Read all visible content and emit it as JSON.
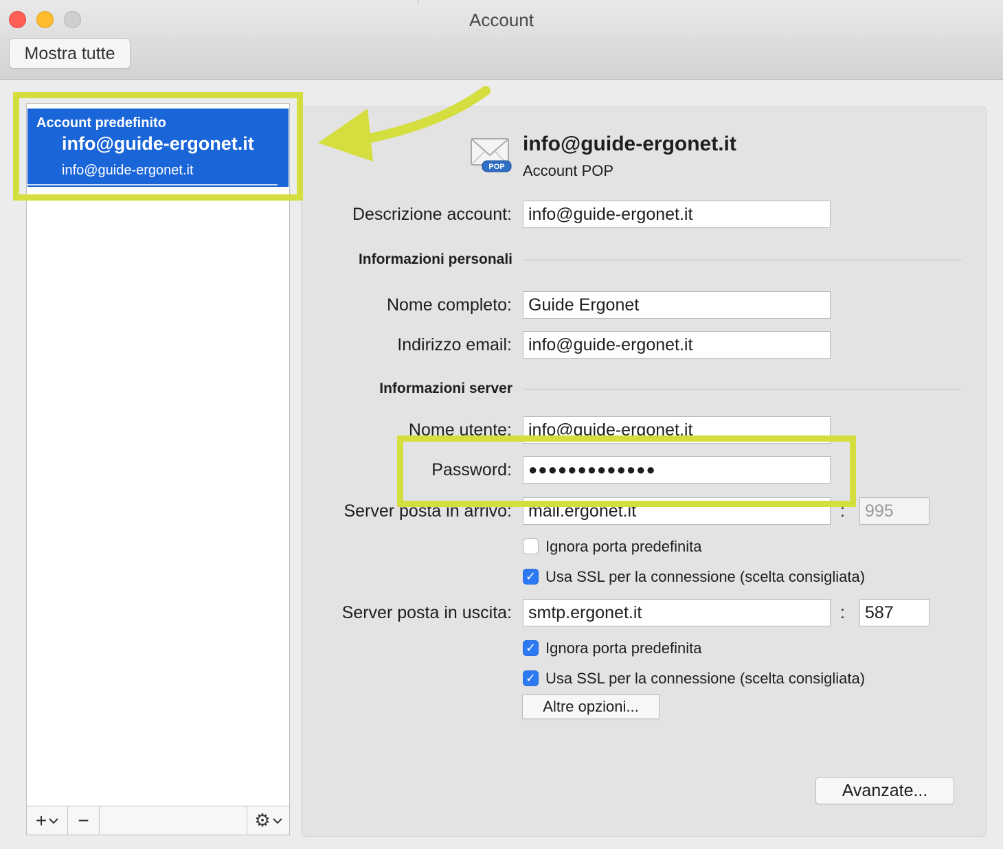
{
  "window": {
    "title": "Account"
  },
  "toolbar": {
    "show_all_label": "Mostra tutte"
  },
  "sidebar": {
    "selected_account": {
      "default_label": "Account predefinito",
      "name": "info@guide-ergonet.it",
      "email": "info@guide-ergonet.it"
    },
    "add_symbol": "+",
    "remove_symbol": "−",
    "gear_symbol": "⚙"
  },
  "header": {
    "title": "info@guide-ergonet.it",
    "subtitle": "Account POP",
    "icon_badge": "POP",
    "icon": "envelope-pop-icon"
  },
  "form": {
    "description_label": "Descrizione account:",
    "description_value": "info@guide-ergonet.it",
    "personal_section": "Informazioni personali",
    "fullname_label": "Nome completo:",
    "fullname_value": "Guide Ergonet",
    "email_label": "Indirizzo email:",
    "email_value": "info@guide-ergonet.it",
    "server_section": "Informazioni server",
    "username_label": "Nome utente:",
    "username_value": "info@guide-ergonet.it",
    "password_label": "Password:",
    "password_value": "●●●●●●●●●●●●●",
    "incoming_label": "Server posta in arrivo:",
    "incoming_value": "mail.ergonet.it",
    "incoming_port": "995",
    "incoming_override_port_label": "Ignora porta predefinita",
    "incoming_override_port_checked": false,
    "incoming_ssl_label": "Usa SSL per la connessione (scelta consigliata)",
    "incoming_ssl_checked": true,
    "outgoing_label": "Server posta in uscita:",
    "outgoing_value": "smtp.ergonet.it",
    "outgoing_port": "587",
    "outgoing_override_port_label": "Ignora porta predefinita",
    "outgoing_override_port_checked": true,
    "outgoing_ssl_label": "Usa SSL per la connessione (scelta consigliata)",
    "outgoing_ssl_checked": true,
    "colon": ":",
    "check_glyph": "✓",
    "more_options_label": "Altre opzioni...",
    "advanced_label": "Avanzate..."
  },
  "colors": {
    "selection_blue": "#1a65d8",
    "highlight_yellow": "#d5de3f",
    "checkbox_blue": "#2d79f4"
  }
}
